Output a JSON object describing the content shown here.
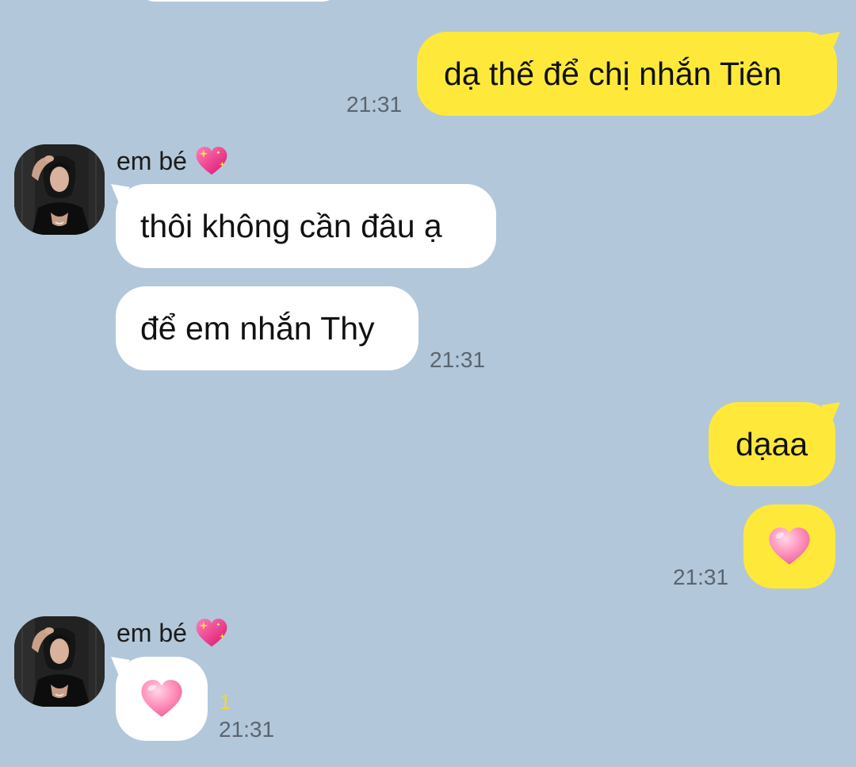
{
  "colors": {
    "background": "#b2c7da",
    "my_bubble": "#fee93b",
    "their_bubble": "#ffffff",
    "timestamp": "#5b6570",
    "unread": "#f2d53a"
  },
  "messages": {
    "m1": {
      "text": "dạ thế để chị nhắn Tiên",
      "time": "21:31"
    },
    "g1": {
      "sender": "em bé",
      "sender_icon": "sparkling-heart-icon",
      "avatar": "avatar-photo",
      "msg_a": "thôi không cần đâu ạ",
      "msg_b": "để em nhắn Thy",
      "time": "21:31"
    },
    "m2": {
      "text": "dạaa"
    },
    "m3": {
      "sticker": "pink-heart-icon",
      "time": "21:31"
    },
    "g2": {
      "sender": "em bé",
      "sender_icon": "sparkling-heart-icon",
      "avatar": "avatar-photo",
      "sticker": "pink-heart-icon",
      "unread": "1",
      "time": "21:31"
    }
  }
}
